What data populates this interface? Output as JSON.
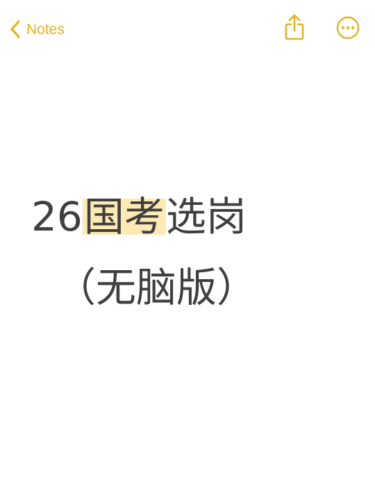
{
  "nav": {
    "back_label": "Notes",
    "back_icon": "chevron-left-icon",
    "share_icon": "share-icon",
    "more_icon": "ellipsis-circle-icon"
  },
  "note": {
    "title_prefix": "26",
    "title_highlight": "国考",
    "title_suffix": "选岗",
    "subtitle": "（无脑版）"
  },
  "colors": {
    "accent": "#e3b21c",
    "text": "#3f3f3f",
    "highlight": "#fde9b3",
    "background": "#ffffff"
  }
}
